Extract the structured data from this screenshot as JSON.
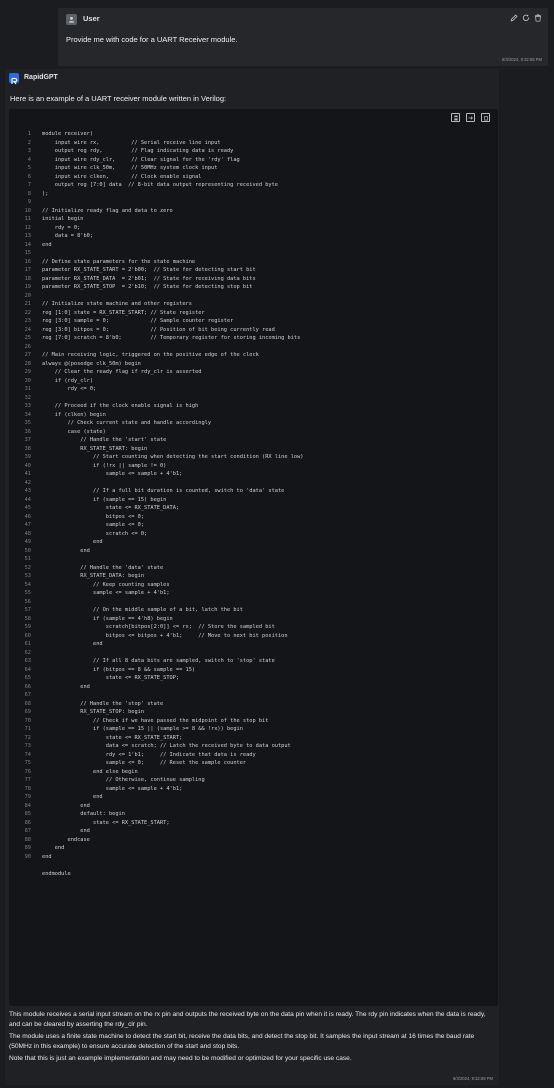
{
  "user": {
    "name": "User",
    "message": "Provide me with code for a UART Receiver module.",
    "timestamp": "6/3/2024, 9:32:58 PM"
  },
  "assistant": {
    "name": "RapidGPT",
    "intro": "Here is an example of a UART receiver module written in Verilog:",
    "code_lines": [
      "module receiver(",
      "    input wire rx,          // Serial receive line input",
      "    output reg rdy,         // Flag indicating data is ready",
      "    input wire rdy_clr,     // Clear signal for the 'rdy' flag",
      "    input wire clk_50m,     // 50MHz system clock input",
      "    input wire clken,       // Clock enable signal",
      "    output reg [7:0] data  // 8-bit data output representing received byte",
      ");",
      "",
      "// Initialize ready flag and data to zero",
      "initial begin",
      "    rdy = 0;",
      "    data = 8'b0;",
      "end",
      "",
      "// Define state parameters for the state machine",
      "parameter RX_STATE_START = 2'b00;  // State for detecting start bit",
      "parameter RX_STATE_DATA  = 2'b01;  // State for receiving data bits",
      "parameter RX_STATE_STOP  = 2'b10;  // State for detecting stop bit",
      "",
      "// Initialize state machine and other registers",
      "reg [1:0] state = RX_STATE_START; // State register",
      "reg [3:0] sample = 0;             // Sample counter register",
      "reg [3:0] bitpos = 0;             // Position of bit being currently read",
      "reg [7:0] scratch = 8'b0;         // Temporary register for storing incoming bits",
      "",
      "// Main receiving logic, triggered on the positive edge of the clock",
      "always @(posedge clk_50m) begin",
      "    // Clear the ready flag if rdy_clr is asserted",
      "    if (rdy_clr)",
      "        rdy <= 0;",
      "",
      "    // Proceed if the clock enable signal is high",
      "    if (clken) begin",
      "        // Check current state and handle accordingly",
      "        case (state)",
      "            // Handle the 'start' state",
      "            RX_STATE_START: begin",
      "                // Start counting when detecting the start condition (RX line low)",
      "                if (!rx || sample != 0)",
      "                    sample <= sample + 4'b1;",
      "",
      "                // If a full bit duration is counted, switch to 'data' state",
      "                if (sample == 15) begin",
      "                    state <= RX_STATE_DATA;",
      "                    bitpos <= 0;",
      "                    sample <= 0;",
      "                    scratch <= 0;",
      "                end",
      "            end",
      "",
      "            // Handle the 'data' state",
      "            RX_STATE_DATA: begin",
      "                // Keep counting samples",
      "                sample <= sample + 4'b1;",
      "",
      "                // On the middle sample of a bit, latch the bit",
      "                if (sample == 4'h8) begin",
      "                    scratch[bitpos[2:0]] <= rx;  // Store the sampled bit",
      "                    bitpos <= bitpos + 4'b1;     // Move to next bit position",
      "                end",
      "",
      "                // If all 8 data bits are sampled, switch to 'stop' state",
      "                if (bitpos == 8 && sample == 15)",
      "                    state <= RX_STATE_STOP;",
      "            end",
      "",
      "            // Handle the 'stop' state",
      "            RX_STATE_STOP: begin",
      "                // Check if we have passed the midpoint of the stop bit",
      "                if (sample == 15 || (sample >= 8 && !rx)) begin",
      "                    state <= RX_STATE_START;",
      "                    data <= scratch; // Latch the received byte to data output",
      "                    rdy <= 1'b1;     // Indicate that data is ready",
      "                    sample <= 0;     // Reset the sample counter",
      "                end else begin",
      "                    // Otherwise, continue sampling",
      "                    sample <= sample + 4'b1;",
      "                end",
      "            end",
      "            default: begin",
      "                state <= RX_STATE_START;",
      "            end",
      "        endcase",
      "    end",
      "end",
      "",
      "endmodule"
    ],
    "code_line_numbers": [
      "1",
      "2",
      "3",
      "4",
      "5",
      "6",
      "7",
      "8",
      "9",
      "10",
      "11",
      "12",
      "13",
      "14",
      "15",
      "16",
      "17",
      "18",
      "19",
      "20",
      "21",
      "22",
      "23",
      "24",
      "25",
      "26",
      "27",
      "28",
      "29",
      "30",
      "31",
      "32",
      "33",
      "34",
      "35",
      "36",
      "37",
      "38",
      "39",
      "40",
      "41",
      "42",
      "43",
      "44",
      "45",
      "46",
      "47",
      "48",
      "49",
      "50",
      "51",
      "52",
      "53",
      "54",
      "55",
      "56",
      "57",
      "58",
      "59",
      "60",
      "61",
      "62",
      "63",
      "64",
      "65",
      "66",
      "67",
      "68",
      "69",
      "70",
      "71",
      "72",
      "73",
      "74",
      "75",
      "76",
      "77",
      "78",
      "79",
      "84",
      "85",
      "86",
      "87",
      "88",
      "89",
      "90"
    ],
    "paragraphs": [
      "This module receives a serial input stream on the rx pin and outputs the received byte on the data pin when it is ready. The rdy pin indicates when the data is ready, and can be cleared by asserting the rdy_clr pin.",
      "The module uses a finite state machine to detect the start bit, receive the data bits, and detect the stop bit. It samples the input stream at 16 times the baud rate (50MHz in this example) to ensure accurate detection of the start and stop bits.",
      "Note that this is just an example implementation and may need to be modified or optimized for your specific use case."
    ],
    "timestamp": "6/3/2024, 9:32:59 PM"
  },
  "colors": {
    "background": "#1b1c1f",
    "user_bubble": "#26272b",
    "code_background": "#141518",
    "accent": "#2d6cdf"
  },
  "icons": {
    "user": "user-icon",
    "edit": "pencil-icon",
    "regenerate": "refresh-icon",
    "delete": "trash-icon",
    "assistant": "bot-logo-icon",
    "save": "save-icon",
    "export": "export-icon",
    "copy": "copy-icon"
  }
}
